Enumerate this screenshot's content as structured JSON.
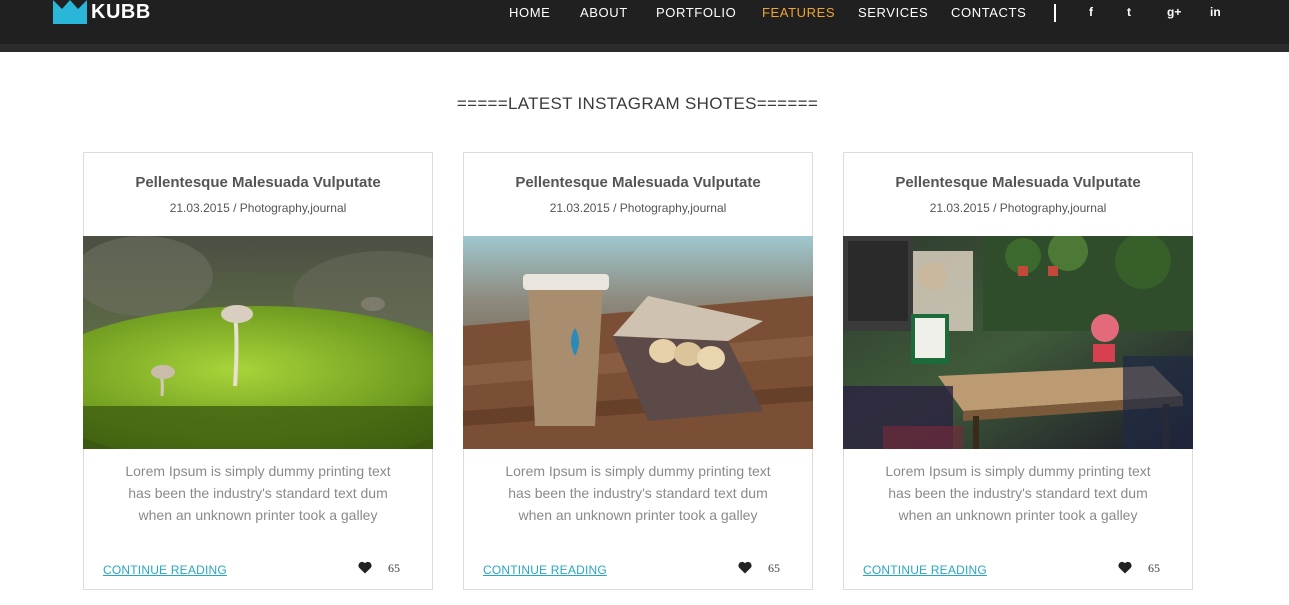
{
  "header": {
    "logo_text": "KUBB",
    "nav": [
      "HOME",
      "ABOUT",
      "PORTFOLIO",
      "FEATURES",
      "SERVICES",
      "CONTACTS"
    ],
    "active": "FEATURES",
    "accent_color": "#f0a431",
    "social": [
      {
        "icon": "facebook-icon",
        "glyph": "f"
      },
      {
        "icon": "twitter-icon",
        "glyph": "t"
      },
      {
        "icon": "google-plus-icon",
        "glyph": "g+"
      },
      {
        "icon": "linkedin-icon",
        "glyph": "in"
      }
    ]
  },
  "section": {
    "title": "=====LATEST INSTAGRAM SHOTES======"
  },
  "cards": [
    {
      "title": "Pellentesque Malesuada Vulputate",
      "meta": "21.03.2015 / Photography,journal",
      "image": "moss-mushroom-photo",
      "text": [
        "Lorem Ipsum is simply dummy printing text",
        "has been the industry's standard text dum",
        "when an unknown printer took a galley"
      ],
      "link": "CONTINUE READING",
      "likes": "65"
    },
    {
      "title": "Pellentesque Malesuada Vulputate",
      "meta": "21.03.2015 / Photography,journal",
      "image": "coffee-macarons-photo",
      "text": [
        "Lorem Ipsum is simply dummy printing text",
        "has been the industry's standard text dum",
        "when an unknown printer took a galley"
      ],
      "link": "CONTINUE READING",
      "likes": "65"
    },
    {
      "title": "Pellentesque Malesuada Vulputate",
      "meta": "21.03.2015 / Photography,journal",
      "image": "cafe-terrace-photo",
      "text": [
        "Lorem Ipsum is simply dummy printing text",
        "has been the industry's standard text dum",
        "when an unknown printer took a galley"
      ],
      "link": "CONTINUE READING",
      "likes": "65"
    }
  ],
  "colors": {
    "header_bg": "#202020",
    "link": "#27a7c4",
    "logo": "#29b6d8"
  }
}
